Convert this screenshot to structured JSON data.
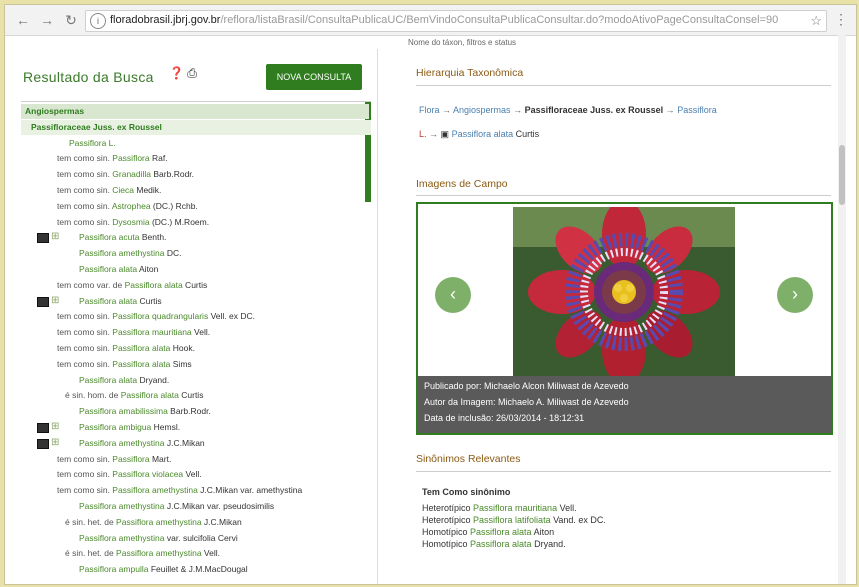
{
  "browser": {
    "url_host": "floradobrasil.jbrj.gov.br",
    "url_path": "/reflora/listaBrasil/ConsultaPublicaUC/BemVindoConsultaPublicaConsultar.do?modoAtivoPageConsultaConsel=90"
  },
  "left": {
    "title": "Resultado da Busca",
    "new_button": "NOVA CONSULTA",
    "tree": [
      {
        "label": "Angiospermas",
        "kind": "hl1"
      },
      {
        "label": "Passifloraceae Juss. ex Roussel",
        "kind": "hl2"
      },
      {
        "label": "Passiflora L.",
        "kind": "genus"
      },
      {
        "pre": "tem como sin. ",
        "sp": "Passiflora",
        "post": " Raf."
      },
      {
        "pre": "tem como sin. ",
        "sp": "Granadilla",
        "post": " Barb.Rodr."
      },
      {
        "pre": "tem como sin. ",
        "sp": "Cieca",
        "post": " Medik."
      },
      {
        "pre": "tem como sin. ",
        "sp": "Astrophea",
        "post": " (DC.) Rchb."
      },
      {
        "pre": "tem como sin. ",
        "sp": "Dysosmia",
        "post": " (DC.) M.Roem."
      },
      {
        "sp": "Passiflora acuta",
        "post": " Benth.",
        "icon": true
      },
      {
        "sp": "Passiflora amethystina",
        "post": " DC."
      },
      {
        "sp": "Passiflora alata",
        "post": " Aiton"
      },
      {
        "pre": "tem como var. de ",
        "sp": "Passiflora alata",
        "post": " Curtis"
      },
      {
        "sp": "Passiflora alata",
        "post": " Curtis",
        "icon": true
      },
      {
        "pre": "tem como sin. ",
        "sp": "Passiflora quadrangularis",
        "post": " Vell. ex DC."
      },
      {
        "pre": "tem como sin. ",
        "sp": "Passiflora mauritiana",
        "post": " Vell."
      },
      {
        "pre": "tem como sin. ",
        "sp": "Passiflora alata",
        "post": " Hook."
      },
      {
        "pre": "tem como sin. ",
        "sp": "Passiflora alata",
        "post": " Sims"
      },
      {
        "sp": "Passiflora alata",
        "post": " Dryand."
      },
      {
        "pre": "é sin. hom. de ",
        "sp": "Passiflora alata",
        "post": " Curtis"
      },
      {
        "sp": "Passiflora amabilissima",
        "post": " Barb.Rodr."
      },
      {
        "sp": "Passiflora ambigua",
        "post": " Hemsl.",
        "icon": true
      },
      {
        "sp": "Passiflora amethystina",
        "post": " J.C.Mikan",
        "icon": true
      },
      {
        "pre": "tem como sin. ",
        "sp": "Passiflora",
        "post": " Mart."
      },
      {
        "pre": "tem como sin. ",
        "sp": "Passiflora violacea",
        "post": " Vell."
      },
      {
        "pre": "tem como sin. ",
        "sp": "Passiflora amethystina",
        "post": " J.C.Mikan var. amethystina"
      },
      {
        "sp": "Passiflora amethystina",
        "post": " J.C.Mikan var. pseudosimilis"
      },
      {
        "pre": "é sin. het. de ",
        "sp": "Passiflora amethystina",
        "post": " J.C.Mikan"
      },
      {
        "sp": "Passiflora amethystina",
        "post": " var. sulcifolia Cervi"
      },
      {
        "pre": "é sin. het. de ",
        "sp": "Passiflora amethystina",
        "post": " Vell."
      },
      {
        "sp": "Passiflora ampulla",
        "post": " Feuillet & J.M.MacDougal"
      }
    ]
  },
  "right": {
    "subnote": "Nome do táxon, filtros e status",
    "hier_title": "Hierarquia Taxonômica",
    "crumbs1": [
      "Flora",
      "Angiospermas",
      "Passifloraceae Juss. ex Roussel",
      "Passiflora"
    ],
    "crumbs2": [
      "L.",
      "Passiflora alata",
      "Curtis"
    ],
    "img_title": "Imagens de Campo",
    "caption": {
      "line1": "Publicado por: Michaelo Alcon Miliwast de Azevedo",
      "line2": "Autor da Imagem: Michaelo A. Miliwast de Azevedo",
      "line3": "Data de inclusão: 26/03/2014 - 18:12:31"
    },
    "syn_title": "Sinônimos Relevantes",
    "syn_head": "Tem Como sinônimo",
    "synonyms": [
      {
        "pre": "Heterotípico ",
        "sp": "Passiflora mauritiana",
        "post": " Vell."
      },
      {
        "pre": "Heterotípico ",
        "sp": "Passiflora latifoliata",
        "post": " Vand. ex DC."
      },
      {
        "pre": "Homotípico ",
        "sp": "Passiflora alata",
        "post": " Aiton"
      },
      {
        "pre": "Homotípico ",
        "sp": "Passiflora alata",
        "post": " Dryand."
      }
    ]
  },
  "colors": {
    "brand_green": "#2f7d1e",
    "section_title": "#8a5a12",
    "link_blue": "#4a7fb0"
  }
}
